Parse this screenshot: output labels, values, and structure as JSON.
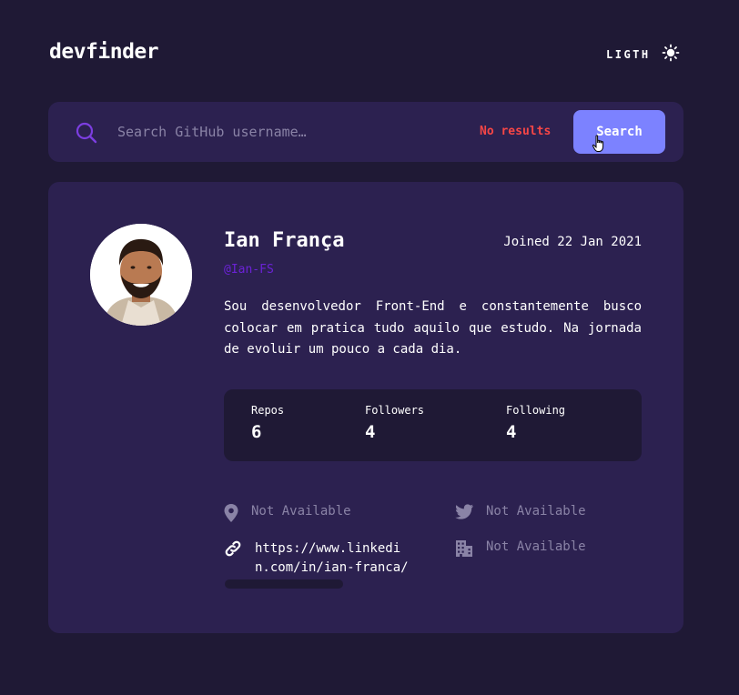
{
  "header": {
    "logo": "devfinder",
    "theme_label": "LIGTH"
  },
  "search": {
    "placeholder": "Search GitHub username…",
    "value": "",
    "no_results": "No results",
    "button_label": "Search"
  },
  "profile": {
    "name": "Ian França",
    "handle": "@Ian-FS",
    "joined": "Joined 22 Jan 2021",
    "bio": "Sou desenvolvedor Front-End e constantemente busco colocar em pratica tudo aquilo que estudo. Na jornada de evoluir um pouco a cada dia.",
    "stats": {
      "repos_label": "Repos",
      "repos": "6",
      "followers_label": "Followers",
      "followers": "4",
      "following_label": "Following",
      "following": "4"
    },
    "links": {
      "location": "Not Available",
      "twitter": "Not Available",
      "blog": "https://www.linkedin.com/in/ian-franca/",
      "company": "Not Available"
    }
  },
  "colors": {
    "background": "#1f1935",
    "card": "#2c2150",
    "accent": "#7c82ff",
    "handle": "#6b22d6",
    "error": "#f74646",
    "muted": "#8a83a6"
  },
  "icons": [
    "sun-icon",
    "search-icon",
    "pointer-cursor-icon",
    "location-pin-icon",
    "twitter-icon",
    "link-icon",
    "building-icon"
  ]
}
